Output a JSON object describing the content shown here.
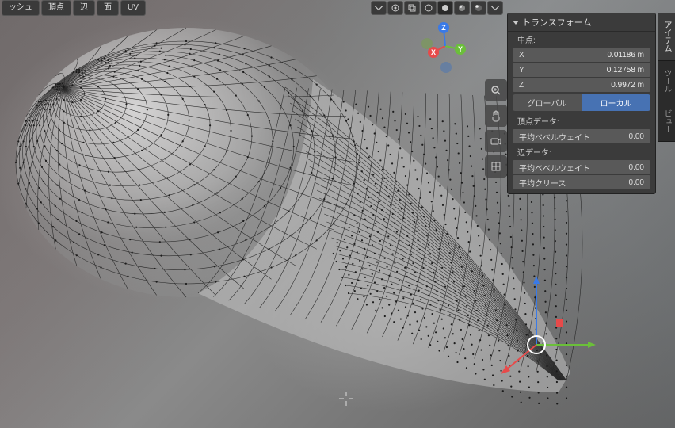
{
  "topbar": {
    "buttons": [
      "ッシュ",
      "頂点",
      "辺",
      "面",
      "UV"
    ]
  },
  "panel": {
    "title": "トランスフォーム",
    "median_label": "中点:",
    "coords": [
      {
        "axis": "X",
        "value": "0.01186 m"
      },
      {
        "axis": "Y",
        "value": "0.12758 m"
      },
      {
        "axis": "Z",
        "value": "0.9972 m"
      }
    ],
    "space": {
      "global": "グローバル",
      "local": "ローカル"
    },
    "vertex_data_label": "頂点データ:",
    "vertex_rows": [
      {
        "label": "平均ベベルウェイト",
        "value": "0.00"
      }
    ],
    "edge_data_label": "辺データ:",
    "edge_rows": [
      {
        "label": "平均ベベルウェイト",
        "value": "0.00"
      },
      {
        "label": "平均クリース",
        "value": "0.00"
      }
    ]
  },
  "tabs": [
    "アイテム",
    "ツール",
    "ビュー"
  ],
  "gizmo": {
    "x": "X",
    "y": "Y",
    "z": "Z"
  },
  "colors": {
    "x": "#e74a4a",
    "y": "#6bbf3a",
    "z": "#3a7ae7",
    "panel_accent": "#4772b3"
  }
}
